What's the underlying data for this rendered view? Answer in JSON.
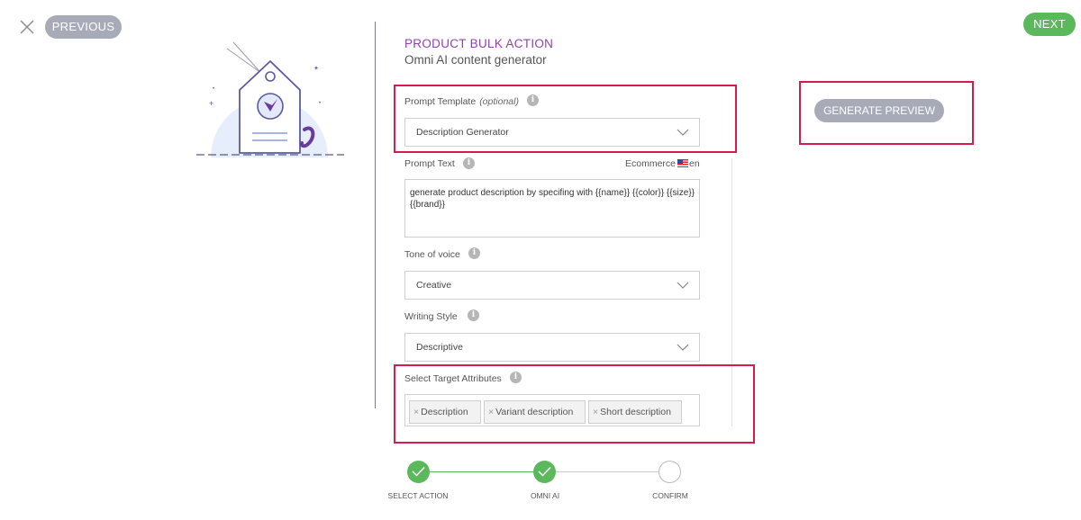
{
  "nav": {
    "previous_label": "PREVIOUS",
    "next_label": "NEXT"
  },
  "panel": {
    "title": "PRODUCT BULK ACTION",
    "subtitle": "Omni AI content generator"
  },
  "prompt_template": {
    "label": "Prompt Template",
    "optional": "(optional)",
    "value": "Description Generator"
  },
  "prompt_text": {
    "label": "Prompt Text",
    "context": "Ecommerce",
    "language": "en",
    "value": "generate product description by specifing with {{name}} {{color}} {{size}} {{brand}}"
  },
  "tone": {
    "label": "Tone of voice",
    "value": "Creative"
  },
  "writing_style": {
    "label": "Writing Style",
    "value": "Descriptive"
  },
  "target_attributes": {
    "label": "Select Target Attributes",
    "tags": [
      "Description",
      "Variant description",
      "Short description"
    ]
  },
  "generate_preview_label": "GENERATE PREVIEW",
  "steps": [
    {
      "label": "SELECT ACTION",
      "status": "done"
    },
    {
      "label": "OMNI AI",
      "status": "done"
    },
    {
      "label": "CONFIRM",
      "status": "pending"
    }
  ],
  "colors": {
    "accent_purple": "#8e44ad",
    "success_green": "#5cb85c",
    "highlight_red": "#d81b4a",
    "button_gray": "#a7abb8"
  },
  "icons": {
    "close": "close-icon",
    "info": "info-icon",
    "chevron": "chevron-down-icon",
    "check": "check-icon",
    "flag": "us-flag-icon"
  }
}
